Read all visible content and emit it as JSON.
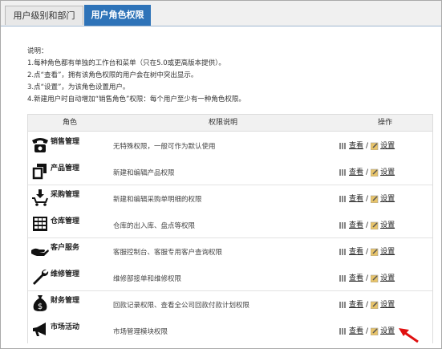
{
  "tabs": [
    {
      "label": "用户级别和部门",
      "active": false
    },
    {
      "label": "用户角色权限",
      "active": true
    }
  ],
  "notes": [
    "说明：",
    "1.每种角色都有单独的工作台和菜单（只在5.0或更高版本提供）。",
    "2.点“查看”，拥有该角色权限的用户会在树中突出显示。",
    "3.点“设置”，为该角色设置用户。",
    "4.新建用户时自动增加“销售角色”权限：每个用户至少有一种角色权限。"
  ],
  "table": {
    "headers": {
      "role": "角色",
      "desc": "权限说明",
      "ops": "操作"
    },
    "rows": [
      {
        "icon": "telephone-icon",
        "name": "销售管理",
        "desc": "无特殊权限，一般可作为默认使用"
      },
      {
        "icon": "product-box-icon",
        "name": "产品管理",
        "desc": "新建和编辑产品权限"
      },
      {
        "icon": "cart-download-icon",
        "name": "采购管理",
        "desc": "新建和编辑采购单明细的权限"
      },
      {
        "icon": "warehouse-icon",
        "name": "仓库管理",
        "desc": "仓库的出入库、盘点等权限"
      },
      {
        "icon": "handshake-icon",
        "name": "客户服务",
        "desc": "客服控制台、客服专用客户查询权限"
      },
      {
        "icon": "wrench-icon",
        "name": "维修管理",
        "desc": "维修部接单和维修权限"
      },
      {
        "icon": "money-bag-icon",
        "name": "财务管理",
        "desc": "回款记录权限、查看全公司回款付款计划权限"
      },
      {
        "icon": "megaphone-icon",
        "name": "市场活动",
        "desc": "市场管理模块权限"
      }
    ],
    "view_label": "查看",
    "set_label": "设置",
    "separator": "/"
  }
}
